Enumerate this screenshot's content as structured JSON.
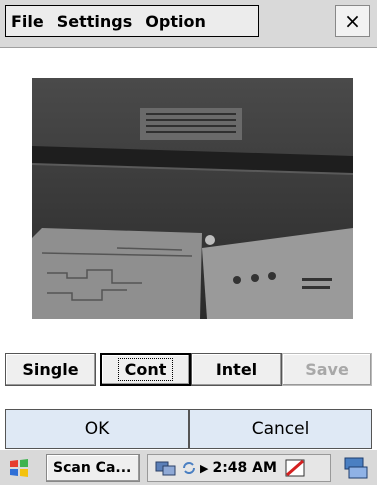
{
  "menubar": {
    "items": [
      "File",
      "Settings",
      "Option"
    ],
    "close_label": "×"
  },
  "mode_buttons": {
    "single": "Single",
    "cont": "Cont",
    "intel": "Intel",
    "save": "Save"
  },
  "actions": {
    "ok": "OK",
    "cancel": "Cancel"
  },
  "taskbar": {
    "app_label": "Scan Ca...",
    "time": "2:48 AM"
  },
  "icons": {
    "start": "windows-start-icon",
    "network": "network-icon",
    "sync": "sync-icon",
    "tray_arrow": "tray-expand-icon",
    "status": "pen-status-icon",
    "keyboard": "input-panel-icon"
  },
  "colors": {
    "menu_bg": "#d9d9d9",
    "action_bg": "#dfe9f5",
    "preview_bg": "#3a3a3a"
  }
}
